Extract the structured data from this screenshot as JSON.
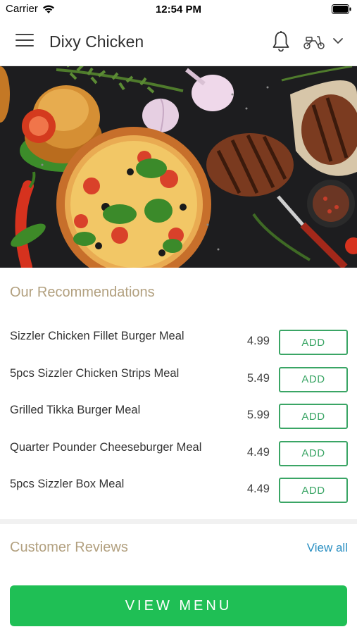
{
  "status_bar": {
    "carrier": "Carrier",
    "time": "12:54 PM",
    "icons": [
      "wifi-icon",
      "battery-icon"
    ]
  },
  "header": {
    "title": "Dixy Chicken",
    "icons": [
      "menu-icon",
      "bell-icon",
      "scooter-icon",
      "chevron-down-icon"
    ]
  },
  "hero": {
    "icons": [
      "food-banner-image"
    ]
  },
  "recommendations": {
    "title": "Our Recommendations",
    "items": [
      {
        "name": "Sizzler Chicken Fillet Burger Meal",
        "price": "4.99",
        "action": "ADD"
      },
      {
        "name": "5pcs Sizzler Chicken Strips Meal",
        "price": "5.49",
        "action": "ADD"
      },
      {
        "name": "Grilled Tikka Burger Meal",
        "price": "5.99",
        "action": "ADD"
      },
      {
        "name": "Quarter Pounder Cheeseburger Meal",
        "price": "4.49",
        "action": "ADD"
      },
      {
        "name": "5pcs Sizzler Box Meal",
        "price": "4.49",
        "action": "ADD"
      }
    ]
  },
  "reviews": {
    "title": "Customer Reviews",
    "view_all": "View all"
  },
  "footer": {
    "view_menu": "VIEW MENU"
  },
  "colors": {
    "accent_green": "#1fbf55",
    "add_green": "#3aa565",
    "section_title": "#b2a07f",
    "link_blue": "#2a8fc2"
  }
}
